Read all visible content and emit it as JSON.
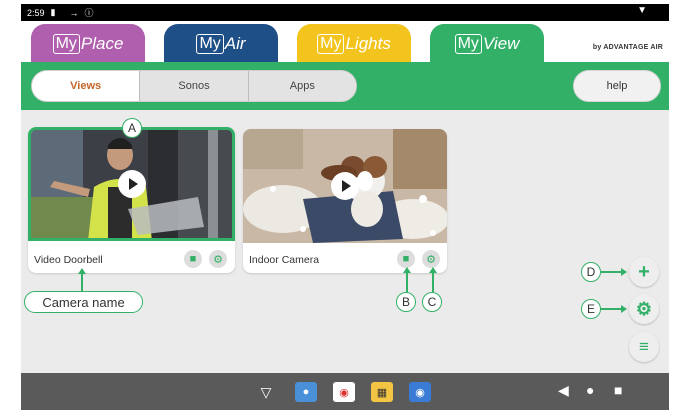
{
  "status": {
    "time": "2:59",
    "left_icons": [
      "battery-icon",
      "signal-icon",
      "info-icon"
    ],
    "right_icon": "wifi-icon"
  },
  "tabs": [
    {
      "box": "My",
      "rest": "Place",
      "color": "#b05fae"
    },
    {
      "box": "My",
      "rest": "Air",
      "color": "#1f4f87"
    },
    {
      "box": "My",
      "rest": "Lights",
      "color": "#f2c41d"
    },
    {
      "box": "My",
      "rest": "View",
      "color": "#33b067"
    }
  ],
  "brand": "by ADVANTAGE AIR",
  "subnav": {
    "items": [
      "Views",
      "Sonos",
      "Apps"
    ],
    "active": "Views"
  },
  "help_label": "help",
  "cameras": [
    {
      "name": "Video Doorbell",
      "selected": true
    },
    {
      "name": "Indoor Camera",
      "selected": false
    }
  ],
  "annotations": {
    "a": "A",
    "b": "B",
    "c": "C",
    "d": "D",
    "e": "E",
    "camera_name": "Camera name"
  },
  "fabs": [
    "plus-icon",
    "gear-icon",
    "menu-icon"
  ],
  "navbar": {
    "apps": [
      "wifi-icon",
      "remote-app-icon",
      "chrome-icon",
      "calendar-app-icon",
      "camera-app-icon"
    ],
    "system": [
      "back-icon",
      "home-icon",
      "recents-icon"
    ]
  },
  "colors": {
    "accent": "#33b067",
    "active_text": "#c4652a"
  }
}
